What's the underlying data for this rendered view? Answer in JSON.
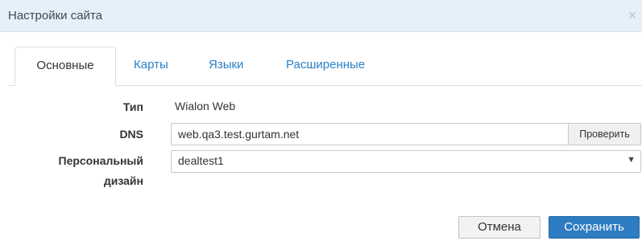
{
  "window": {
    "title": "Настройки сайта",
    "close_glyph": "×",
    "close_icon": "close-icon"
  },
  "tabs": [
    {
      "label": "Основные",
      "active": true
    },
    {
      "label": "Карты",
      "active": false
    },
    {
      "label": "Языки",
      "active": false
    },
    {
      "label": "Расширенные",
      "active": false
    }
  ],
  "form": {
    "type_label": "Тип",
    "type_value": "Wialon Web",
    "dns_label": "DNS",
    "dns_value": "web.qa3.test.gurtam.net",
    "check_button": "Проверить",
    "design_label_line1": "Персональный",
    "design_label_line2": "дизайн",
    "design_value": "dealtest1",
    "design_caret": "▼",
    "design_caret_icon": "chevron-down-icon"
  },
  "footer": {
    "cancel_label": "Отмена",
    "save_label": "Сохранить"
  },
  "colors": {
    "titlebar": "#e6f0f8",
    "tab_link": "#2a80c8",
    "save_button": "#2e7cc1"
  }
}
